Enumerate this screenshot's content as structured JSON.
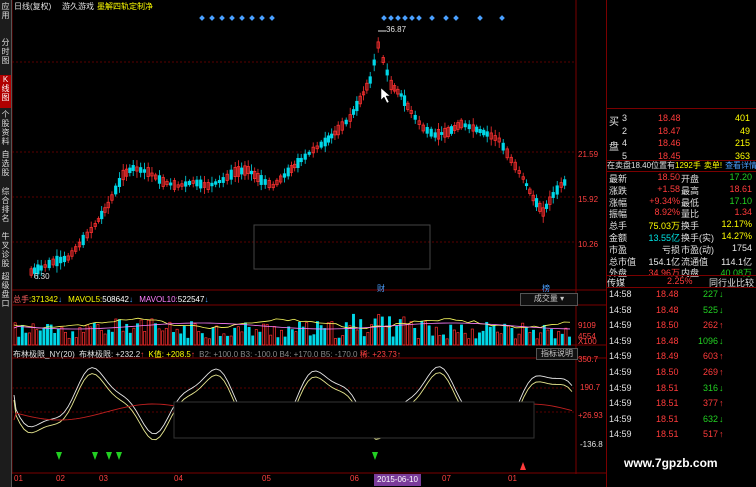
{
  "left_tabs": [
    "应用",
    "分时图",
    "K线图",
    "个股资料",
    "自选股",
    "综合排名",
    "牛叉诊股",
    "超级盘口"
  ],
  "active_tab_index": 2,
  "header": {
    "mode": "日线(复权)",
    "indicator": "游久游戏",
    "line_label": "墨解四轨定制净"
  },
  "price_scale": [
    "21.59",
    "15.92",
    "10.26"
  ],
  "high_label": "36.87",
  "low_label": "6.30",
  "tags": {
    "cai": "财",
    "bei": "榜"
  },
  "volume_header": {
    "title": "总手",
    "total": "371342",
    "mavol5_label": "MAVOL5:",
    "mavol5": "508642",
    "mavol10_label": "MAVOL10:",
    "mavol10": "522547",
    "dropdown": "成交量"
  },
  "volume_scale": [
    "9109",
    "4554",
    "X100"
  ],
  "indicator_header": {
    "name": "布林极限_NY(20)",
    "line1": "布林极限: +232.2",
    "kval": "K值: +208.5",
    "b2": "B2: +100.0",
    "b3": "B3: -100.0",
    "b4": "B4: +170.0",
    "b5": "B5: -170.0",
    "xi": "稀: +23.73",
    "explain": "指标说明"
  },
  "indicator_scale": [
    "350.7",
    "190.7",
    "+26.93",
    "-136.8"
  ],
  "xaxis": [
    "01",
    "02",
    "03",
    "04",
    "05",
    "06",
    "07",
    "01"
  ],
  "date_label": "2015-06-10",
  "order_book": [
    {
      "side": "买",
      "level": "3",
      "price": "18.48",
      "vol": "401"
    },
    {
      "side": "",
      "level": "2",
      "price": "18.47",
      "vol": "49"
    },
    {
      "side": "盘",
      "level": "4",
      "price": "18.46",
      "vol": "215"
    },
    {
      "side": "",
      "level": "5",
      "price": "18.45",
      "vol": "363"
    }
  ],
  "weibi_line": {
    "a": "在卖盘18.40位置有",
    "b": "1292手",
    "c": "卖单!",
    "d": "查看详情"
  },
  "stats": [
    {
      "l1": "最新",
      "v1": "18.50",
      "c1": "red",
      "l2": "开盘",
      "v2": "17.20",
      "c2": "green"
    },
    {
      "l1": "涨跌",
      "v1": "+1.58",
      "c1": "red",
      "l2": "最高",
      "v2": "18.61",
      "c2": "red"
    },
    {
      "l1": "涨幅",
      "v1": "+9.34%",
      "c1": "red",
      "l2": "最低",
      "v2": "17.10",
      "c2": "green"
    },
    {
      "l1": "振幅",
      "v1": "8.92%",
      "c1": "red",
      "l2": "量比",
      "v2": "1.34",
      "c2": "red"
    },
    {
      "l1": "总手",
      "v1": "75.03万",
      "c1": "yellow",
      "l2": "换手",
      "v2": "12.17%",
      "c2": "yellow"
    },
    {
      "l1": "金额",
      "v1": "13.55亿",
      "c1": "cyan",
      "l2": "换手(实)",
      "v2": "14.27%",
      "c2": "yellow"
    },
    {
      "l1": "市盈",
      "v1": "亏损",
      "c1": "white",
      "l2": "市盈(动)",
      "v2": "1754",
      "c2": "white"
    },
    {
      "l1": "总市值",
      "v1": "154.1亿",
      "c1": "white",
      "l2": "流通值",
      "v2": "114.1亿",
      "c2": "white"
    },
    {
      "l1": "外盘",
      "v1": "34.96万",
      "c1": "red",
      "l2": "内盘",
      "v2": "40.08万",
      "c2": "green"
    }
  ],
  "industry": {
    "name": "传媒",
    "pct": "2.25%",
    "link": "同行业比较"
  },
  "ticks": [
    {
      "t": "14:58",
      "p": "18.48",
      "v": "227",
      "d": "down"
    },
    {
      "t": "14:58",
      "p": "18.48",
      "v": "525",
      "d": "down"
    },
    {
      "t": "14:59",
      "p": "18.50",
      "v": "262",
      "d": "up"
    },
    {
      "t": "14:59",
      "p": "18.48",
      "v": "1096",
      "d": "down"
    },
    {
      "t": "14:59",
      "p": "18.49",
      "v": "603",
      "d": "up"
    },
    {
      "t": "14:59",
      "p": "18.50",
      "v": "269",
      "d": "up"
    },
    {
      "t": "14:59",
      "p": "18.51",
      "v": "316",
      "d": "down"
    },
    {
      "t": "14:59",
      "p": "18.51",
      "v": "377",
      "d": "up"
    },
    {
      "t": "14:59",
      "p": "18.51",
      "v": "632",
      "d": "down"
    },
    {
      "t": "14:59",
      "p": "18.51",
      "v": "517",
      "d": "up"
    }
  ],
  "watermark": "www.7gpzb.com"
}
